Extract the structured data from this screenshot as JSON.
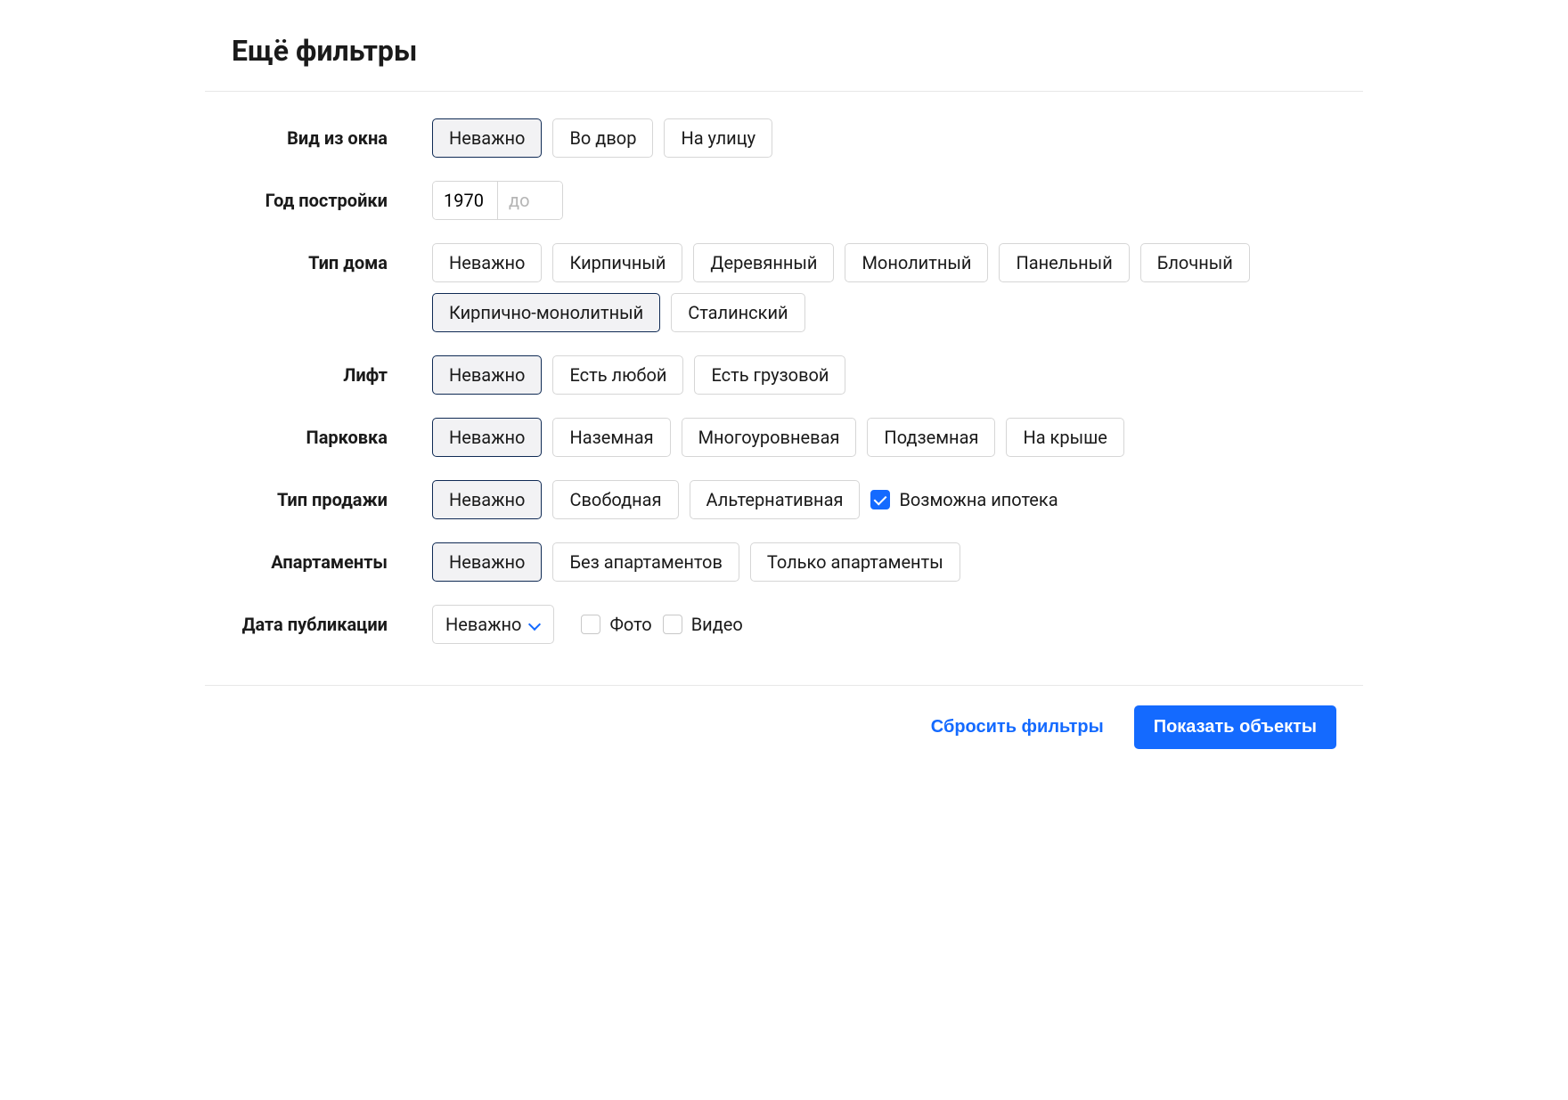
{
  "title": "Ещё фильтры",
  "rows": {
    "window_view": {
      "label": "Вид из окна",
      "options": [
        {
          "label": "Неважно",
          "selected": true
        },
        {
          "label": "Во двор",
          "selected": false
        },
        {
          "label": "На улицу",
          "selected": false
        }
      ]
    },
    "build_year": {
      "label": "Год постройки",
      "from_value": "1970",
      "to_placeholder": "до"
    },
    "house_type": {
      "label": "Тип дома",
      "options": [
        {
          "label": "Неважно",
          "selected": false
        },
        {
          "label": "Кирпичный",
          "selected": false
        },
        {
          "label": "Деревянный",
          "selected": false
        },
        {
          "label": "Монолитный",
          "selected": false
        },
        {
          "label": "Панельный",
          "selected": false
        },
        {
          "label": "Блочный",
          "selected": false
        },
        {
          "label": "Кирпично-монолитный",
          "selected": true
        },
        {
          "label": "Сталинский",
          "selected": false
        }
      ]
    },
    "elevator": {
      "label": "Лифт",
      "options": [
        {
          "label": "Неважно",
          "selected": true
        },
        {
          "label": "Есть любой",
          "selected": false
        },
        {
          "label": "Есть грузовой",
          "selected": false
        }
      ]
    },
    "parking": {
      "label": "Парковка",
      "options": [
        {
          "label": "Неважно",
          "selected": true
        },
        {
          "label": "Наземная",
          "selected": false
        },
        {
          "label": "Многоуровневая",
          "selected": false
        },
        {
          "label": "Подземная",
          "selected": false
        },
        {
          "label": "На крыше",
          "selected": false
        }
      ]
    },
    "sale_type": {
      "label": "Тип продажи",
      "options": [
        {
          "label": "Неважно",
          "selected": true
        },
        {
          "label": "Свободная",
          "selected": false
        },
        {
          "label": "Альтернативная",
          "selected": false
        }
      ],
      "mortgage": {
        "label": "Возможна ипотека",
        "checked": true
      }
    },
    "apartments": {
      "label": "Апартаменты",
      "options": [
        {
          "label": "Неважно",
          "selected": true
        },
        {
          "label": "Без апартаментов",
          "selected": false
        },
        {
          "label": "Только апартаменты",
          "selected": false
        }
      ]
    },
    "publish_date": {
      "label": "Дата публикации",
      "select_value": "Неважно",
      "photo": {
        "label": "Фото",
        "checked": false
      },
      "video": {
        "label": "Видео",
        "checked": false
      }
    }
  },
  "footer": {
    "reset": "Сбросить фильтры",
    "submit": "Показать объекты"
  }
}
